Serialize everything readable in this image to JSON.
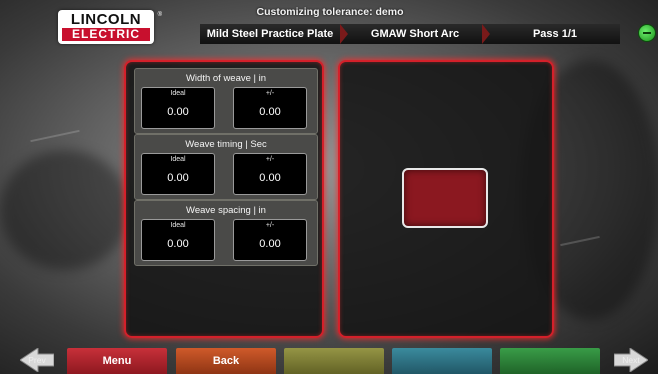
{
  "header": {
    "logo_top": "LINCOLN",
    "logo_bottom": "ELECTRIC",
    "logo_reg": "®",
    "title": "Customizing tolerance: demo",
    "breadcrumbs": [
      "Mild Steel Practice Plate",
      "GMAW Short Arc",
      "Pass 1/1"
    ],
    "status_icon": "status-indicator-icon"
  },
  "tolerances": [
    {
      "title": "Width of weave | in",
      "ideal_label": "Ideal",
      "ideal_value": "0.00",
      "tol_label": "+/-",
      "tol_value": "0.00"
    },
    {
      "title": "Weave timing | Sec",
      "ideal_label": "Ideal",
      "ideal_value": "0.00",
      "tol_label": "+/-",
      "tol_value": "0.00"
    },
    {
      "title": "Weave spacing | in",
      "ideal_label": "Ideal",
      "ideal_value": "0.00",
      "tol_label": "+/-",
      "tol_value": "0.00"
    }
  ],
  "footer": {
    "prev_label": "Prev",
    "next_label": "Next",
    "buttons": [
      {
        "label": "Menu",
        "color": "#b3202a"
      },
      {
        "label": "Back",
        "color": "#b84a1e"
      },
      {
        "label": "",
        "color": "#8a8a30"
      },
      {
        "label": "",
        "color": "#2e7e92"
      },
      {
        "label": "",
        "color": "#2f8a3a"
      }
    ]
  },
  "colors": {
    "accent_red": "#d4202a",
    "target_block": "#8b1820",
    "status_green": "#3cc43c"
  }
}
